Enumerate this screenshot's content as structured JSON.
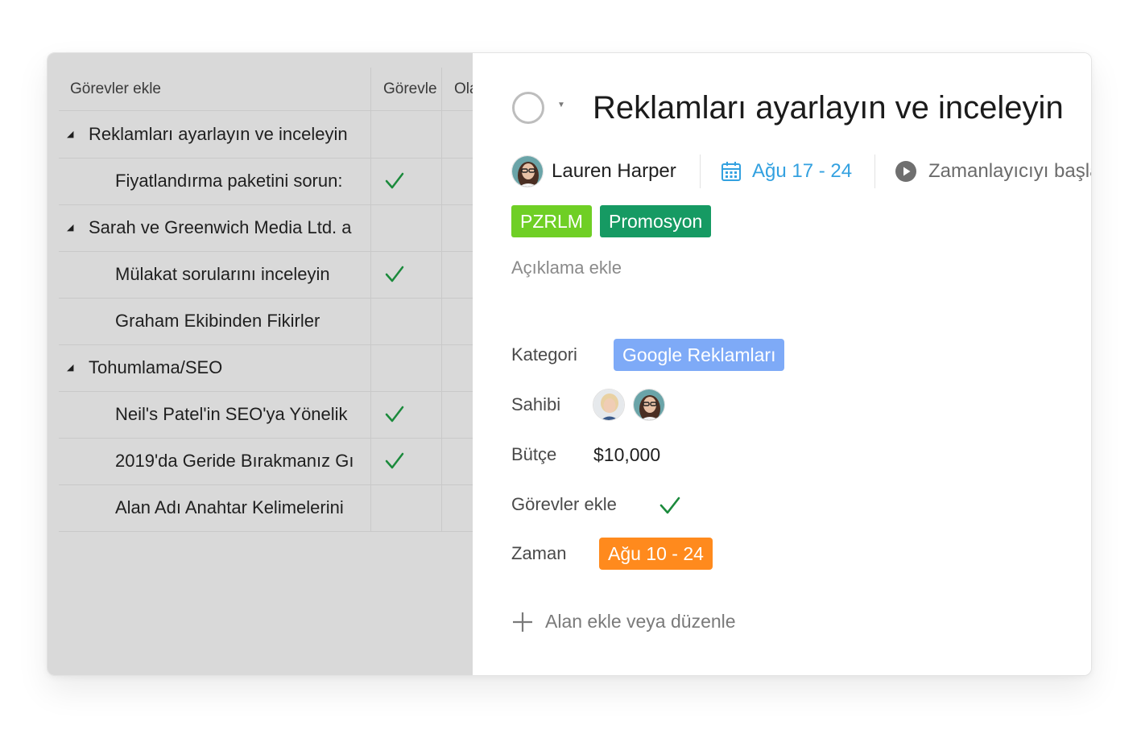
{
  "table": {
    "columns": [
      {
        "label": "Görevler ekle"
      },
      {
        "label": "Görevle"
      },
      {
        "label": "Ola"
      }
    ],
    "rows": [
      {
        "label": "Reklamları ayarlayın ve inceleyin",
        "group": true,
        "checked": false
      },
      {
        "label": "Fiyatlandırma paketini sorun:",
        "group": false,
        "checked": true
      },
      {
        "label": "Sarah ve Greenwich Media Ltd. a",
        "group": true,
        "checked": false
      },
      {
        "label": "Mülakat sorularını inceleyin",
        "group": false,
        "checked": true
      },
      {
        "label": "Graham Ekibinden Fikirler",
        "group": false,
        "checked": false
      },
      {
        "label": "Tohumlama/SEO",
        "group": true,
        "checked": false
      },
      {
        "label": "Neil's Patel'in SEO'ya Yönelik",
        "group": false,
        "checked": true
      },
      {
        "label": "2019'da Geride Bırakmanız Gı",
        "group": false,
        "checked": true
      },
      {
        "label": "Alan Adı Anahtar Kelimelerini",
        "group": false,
        "checked": false
      }
    ]
  },
  "detail": {
    "title": "Reklamları ayarlayın ve inceleyin",
    "assignee": "Lauren Harper",
    "date_range": "Ağu 17 - 24",
    "timer_label": "Zamanlayıcıyı başla",
    "tags": [
      {
        "label": "PZRLM",
        "color": "#6fcf25"
      },
      {
        "label": "Promosyon",
        "color": "#169a63"
      }
    ],
    "description_placeholder": "Açıklama ekle",
    "fields": {
      "category": {
        "label": "Kategori",
        "value": "Google Reklamları",
        "color": "#7eaaf7"
      },
      "owner": {
        "label": "Sahibi"
      },
      "budget": {
        "label": "Bütçe",
        "value": "$10,000"
      },
      "tasks": {
        "label": "Görevler ekle",
        "checked": true
      },
      "time": {
        "label": "Zaman",
        "value": "Ağu 10 - 24",
        "color": "#ff8a1d"
      }
    },
    "add_field_label": "Alan ekle veya düzenle",
    "icons": {
      "status": "circle-status-icon",
      "calendar": "calendar-icon",
      "timer": "play-icon",
      "add": "plus-icon",
      "check": "check-icon"
    },
    "colors": {
      "date": "#33a1e0",
      "check": "#1b8a3c"
    }
  }
}
